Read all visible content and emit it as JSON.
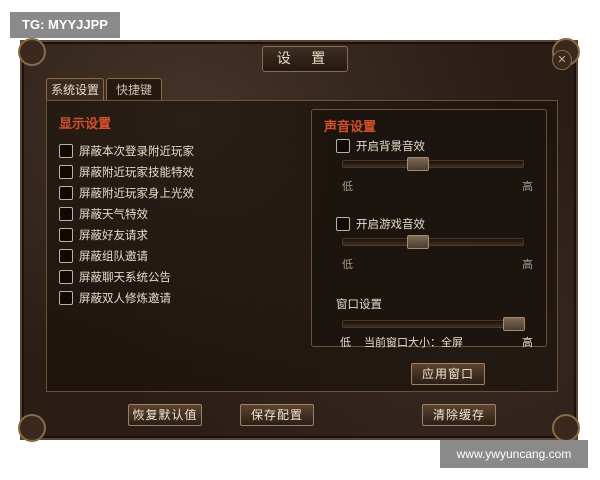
{
  "watermark_top": "TG: MYYJJPP",
  "watermark_bottom": "www.ywyuncang.com",
  "window": {
    "title": "设 置",
    "close_symbol": "✕",
    "tabs": [
      {
        "label": "系统设置",
        "active": true
      },
      {
        "label": "快捷键",
        "active": false
      }
    ]
  },
  "display": {
    "title": "显示设置",
    "options": [
      {
        "label": "屏蔽本次登录附近玩家",
        "checked": false
      },
      {
        "label": "屏蔽附近玩家技能特效",
        "checked": false
      },
      {
        "label": "屏蔽附近玩家身上光效",
        "checked": false
      },
      {
        "label": "屏蔽天气特效",
        "checked": false
      },
      {
        "label": "屏蔽好友请求",
        "checked": false
      },
      {
        "label": "屏蔽组队邀请",
        "checked": false
      },
      {
        "label": "屏蔽聊天系统公告",
        "checked": false
      },
      {
        "label": "屏蔽双人修炼邀请",
        "checked": false
      }
    ]
  },
  "sound": {
    "title": "声音设置",
    "bgm": {
      "label": "开启背景音效",
      "enabled": false,
      "level": 0.4,
      "low": "低",
      "high": "高"
    },
    "game_sfx": {
      "label": "开启游戏音效",
      "enabled": false,
      "level": 0.4,
      "low": "低",
      "high": "高"
    },
    "window_settings": {
      "label": "窗口设置",
      "level": 1.0,
      "low": "低",
      "high": "高",
      "current_size": "当前窗口大小：全屏"
    },
    "apply_button": "应用窗口"
  },
  "buttons": {
    "restore_default": "恢复默认值",
    "save_config": "保存配置",
    "clear_cache": "清除缓存"
  }
}
